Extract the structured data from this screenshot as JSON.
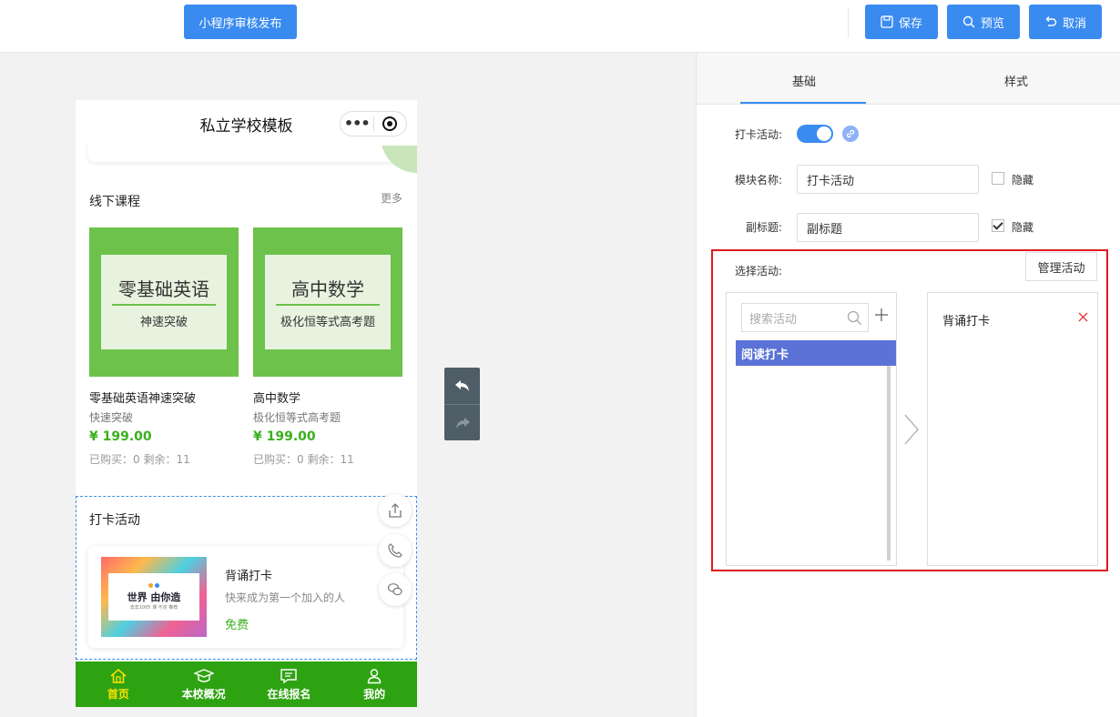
{
  "toolbar": {
    "publish_label": "小程序审核发布",
    "save_label": "保存",
    "preview_label": "预览",
    "cancel_label": "取消"
  },
  "phone": {
    "title": "私立学校模板",
    "capsule_dots": "•••",
    "offline_courses": {
      "title": "线下课程",
      "more": "更多",
      "courses": [
        {
          "cover_title": "零基础英语",
          "cover_sub": "神速突破",
          "name": "零基础英语神速突破",
          "sub": "快速突破",
          "price": "¥ 199.00",
          "stats": "已购买：0 剩余：11"
        },
        {
          "cover_title": "高中数学",
          "cover_sub": "极化恒等式高考题",
          "name": "高中数学",
          "sub": "极化恒等式高考题",
          "price": "¥ 199.00",
          "stats": "已购买：0 剩余：11"
        }
      ]
    },
    "checkin": {
      "title": "打卡活动",
      "image_title": "世界 由你造",
      "image_small": "去去1005 课 不定 推荐",
      "item_title": "背诵打卡",
      "item_desc": "快来成为第一个加入的人",
      "item_price": "免费"
    },
    "tabbar": [
      {
        "label": "首页",
        "icon": "home-icon",
        "active": true
      },
      {
        "label": "本校概况",
        "icon": "graduation-cap-icon",
        "active": false
      },
      {
        "label": "在线报名",
        "icon": "message-icon",
        "active": false
      },
      {
        "label": "我的",
        "icon": "user-icon",
        "active": false
      }
    ]
  },
  "panel": {
    "tabs": [
      "基础",
      "样式"
    ],
    "active_tab": "基础",
    "checkin_label": "打卡活动:",
    "toggle_on": true,
    "module_name_label": "模块名称:",
    "module_name_value": "打卡活动",
    "module_hide_label": "隐藏",
    "module_hide_checked": false,
    "subtitle_label": "副标题:",
    "subtitle_value": "副标题",
    "subtitle_hide_label": "隐藏",
    "subtitle_hide_checked": true,
    "select_label": "选择活动:",
    "manage_label": "管理活动",
    "search_placeholder": "搜索活动",
    "available": [
      "阅读打卡"
    ],
    "selected": [
      "背诵打卡"
    ]
  },
  "colors": {
    "accent": "#3a8bf0",
    "green": "#2ea312",
    "price_green": "#39b01e",
    "highlight": "#e0191e",
    "selected_item": "#5b73d6"
  }
}
